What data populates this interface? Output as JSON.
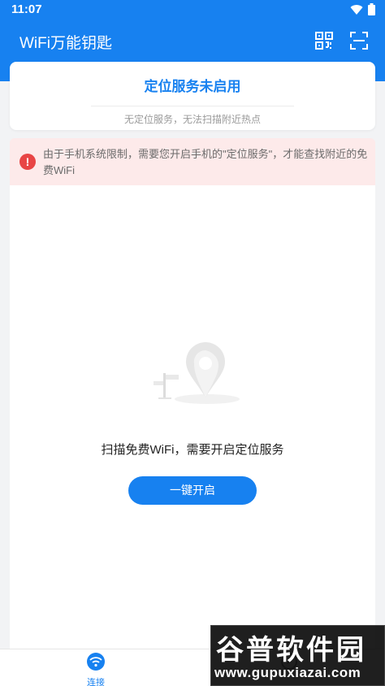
{
  "status_bar": {
    "time": "11:07"
  },
  "app_bar": {
    "title": "WiFi万能钥匙",
    "actions": [
      "qr-code-icon",
      "scan-icon"
    ]
  },
  "location_card": {
    "title": "定位服务未启用",
    "subtitle": "无定位服务，无法扫描附近热点"
  },
  "alert": {
    "text": "由于手机系统限制，需要您开启手机的\"定位服务\"，才能查找附近的免费WiFi",
    "icon": "exclamation-icon"
  },
  "empty_state": {
    "message": "扫描免费WiFi，需要开启定位服务",
    "button_label": "一键开启",
    "illustration": "map-pin-signpost-illustration"
  },
  "bottom_nav": {
    "items": [
      {
        "label": "连接",
        "icon": "wifi-icon",
        "active": true
      },
      {
        "label": "",
        "icon": "discover-icon",
        "active": false
      }
    ]
  },
  "watermark": {
    "logo": "谷普软件园",
    "url": "www.gupuxiazai.com"
  },
  "colors": {
    "primary": "#1781f0",
    "alert_bg": "#fdeaea",
    "alert_icon": "#e84545"
  }
}
